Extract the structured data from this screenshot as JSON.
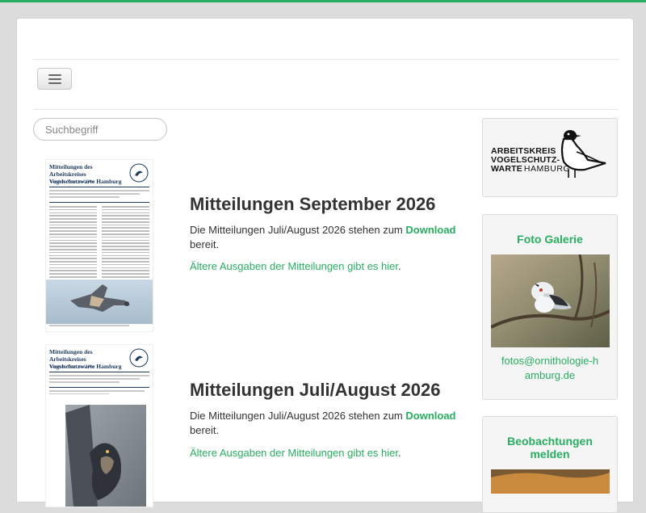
{
  "search": {
    "placeholder": "Suchbegriff"
  },
  "newsletter": {
    "title_line1": "Mitteilungen des Arbeitskreises",
    "title_line2": "Vogelschutzwarte Hamburg",
    "subtitle": "Vögel an Alster und Elbe"
  },
  "articles": [
    {
      "title": "Mitteilungen September 2026",
      "text_before": "Die Mitteilungen Juli/August 2026 stehen zum ",
      "download_label": "Download",
      "text_after": " bereit.",
      "older_link": "Ältere Ausgaben der Mitteilungen gibt es hier",
      "older_after": "."
    },
    {
      "title": "Mitteilungen Juli/August 2026",
      "text_before": "Die Mitteilungen Juli/August 2026 stehen zum ",
      "download_label": "Download",
      "text_after": " bereit.",
      "older_link": "Ältere Ausgaben der Mitteilungen gibt es hier",
      "older_after": "."
    }
  ],
  "sidebar": {
    "logo": {
      "line1": "ARBEITSKREIS",
      "line2": "VOGELSCHUTZ-",
      "line3_bold": "WARTE",
      "line3_light": "HAMBURG"
    },
    "gallery": {
      "title": "Foto Galerie",
      "email": "fotos@ornithologie-hamburg.de"
    },
    "observations": {
      "title": "Beobachtungen melden"
    }
  },
  "colors": {
    "accent": "#27ae60",
    "text": "#333333",
    "background": "#dcdcdc"
  },
  "icons": {
    "menu": "hamburger-menu-icon"
  }
}
